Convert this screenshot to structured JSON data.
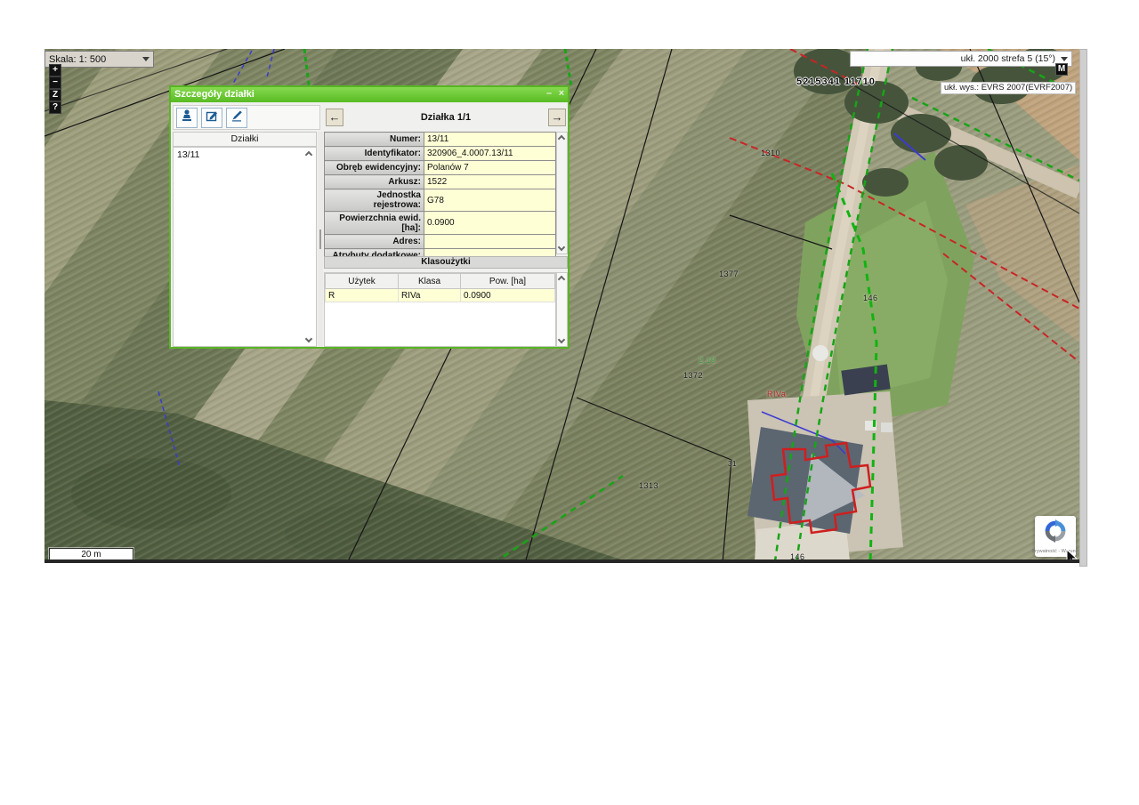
{
  "map": {
    "scale_control": {
      "label": "Skala: 1: 500"
    },
    "zoom_buttons": {
      "zoom_in": "+",
      "zoom_out": "−",
      "z_tool": "Z",
      "help": "?"
    },
    "crs_selector": {
      "label": "ukł. 2000 strefa 5 (15°)"
    },
    "m_button": "M",
    "height_system_label": "ukł. wys.: EVRS 2007(EVRF2007)",
    "coordinates_readout": "5215341 11710",
    "scalebar_label": "20 m",
    "labels": {
      "parcel_1310": "1310",
      "parcel_1377": "1377",
      "parcel_1372": "1372",
      "parcel_1313": "1313",
      "parcel_146_lawn": "146",
      "parcel_146_bottom": "146",
      "landuse_riva": "RIVa",
      "road_point_31": "31",
      "area_green": "2.19"
    }
  },
  "dialog": {
    "title": "Szczegóły działki",
    "minimize_glyph": "–",
    "close_glyph": "×",
    "pager": {
      "title": "Działka 1/1",
      "prev_glyph": "←",
      "next_glyph": "→"
    },
    "list": {
      "header": "Działki",
      "items": [
        "13/11"
      ]
    },
    "fields": [
      {
        "label": "Numer:",
        "value": "13/11"
      },
      {
        "label": "Identyfikator:",
        "value": "320906_4.0007.13/11"
      },
      {
        "label": "Obręb ewidencyjny:",
        "value": "Polanów 7"
      },
      {
        "label": "Arkusz:",
        "value": "1522"
      },
      {
        "label": "Jednostka rejestrowa:",
        "value": "G78"
      },
      {
        "label": "Powierzchnia ewid. [ha]:",
        "value": "0.0900"
      },
      {
        "label": "Adres:",
        "value": ""
      },
      {
        "label": "Atrybuty dodatkowe:",
        "value": ""
      }
    ],
    "landuse": {
      "header": "Klasoużytki",
      "columns": [
        "Użytek",
        "Klasa",
        "Pow. [ha]"
      ],
      "rows": [
        [
          "R",
          "RIVa",
          "0.0900"
        ]
      ]
    }
  },
  "recaptcha": {
    "privacy_terms": "Prywatność - Warunki"
  },
  "colors": {
    "accent_green": "#58bb22",
    "value_bg": "#ffffd6",
    "parcel_highlight": "#cf1f1f"
  }
}
